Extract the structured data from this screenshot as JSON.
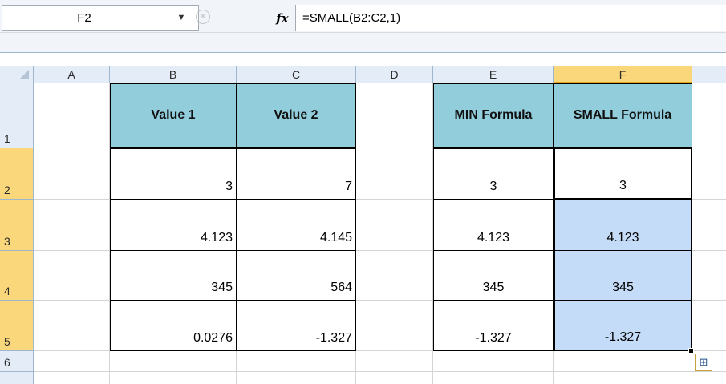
{
  "formula_bar": {
    "name_box": "F2",
    "fx_label": "fx",
    "cancel_glyph": "✕",
    "formula": "=SMALL(B2:C2,1)"
  },
  "columns": [
    "A",
    "B",
    "C",
    "D",
    "E",
    "F"
  ],
  "rows": [
    "1",
    "2",
    "3",
    "4",
    "5",
    "6"
  ],
  "headers": {
    "b1": "Value 1",
    "c1": "Value 2",
    "e1": "MIN Formula",
    "f1": "SMALL Formula"
  },
  "table": [
    {
      "value1": "3",
      "value2": "7",
      "min": "3",
      "small": "3"
    },
    {
      "value1": "4.123",
      "value2": "4.145",
      "min": "4.123",
      "small": "4.123"
    },
    {
      "value1": "345",
      "value2": "564",
      "min": "345",
      "small": "345"
    },
    {
      "value1": "0.0276",
      "value2": "-1.327",
      "min": "-1.327",
      "small": "-1.327"
    }
  ],
  "selected": {
    "column": "F",
    "rows": [
      "2",
      "3",
      "4",
      "5"
    ]
  },
  "icons": {
    "dropdown": "chevron-down-icon",
    "fx": "function-icon",
    "smart_tag": "paste-options-icon"
  },
  "colors": {
    "header_fill": "#92cddc",
    "selection_fill": "#c5dcf8",
    "selected_header": "#f9d77a"
  }
}
